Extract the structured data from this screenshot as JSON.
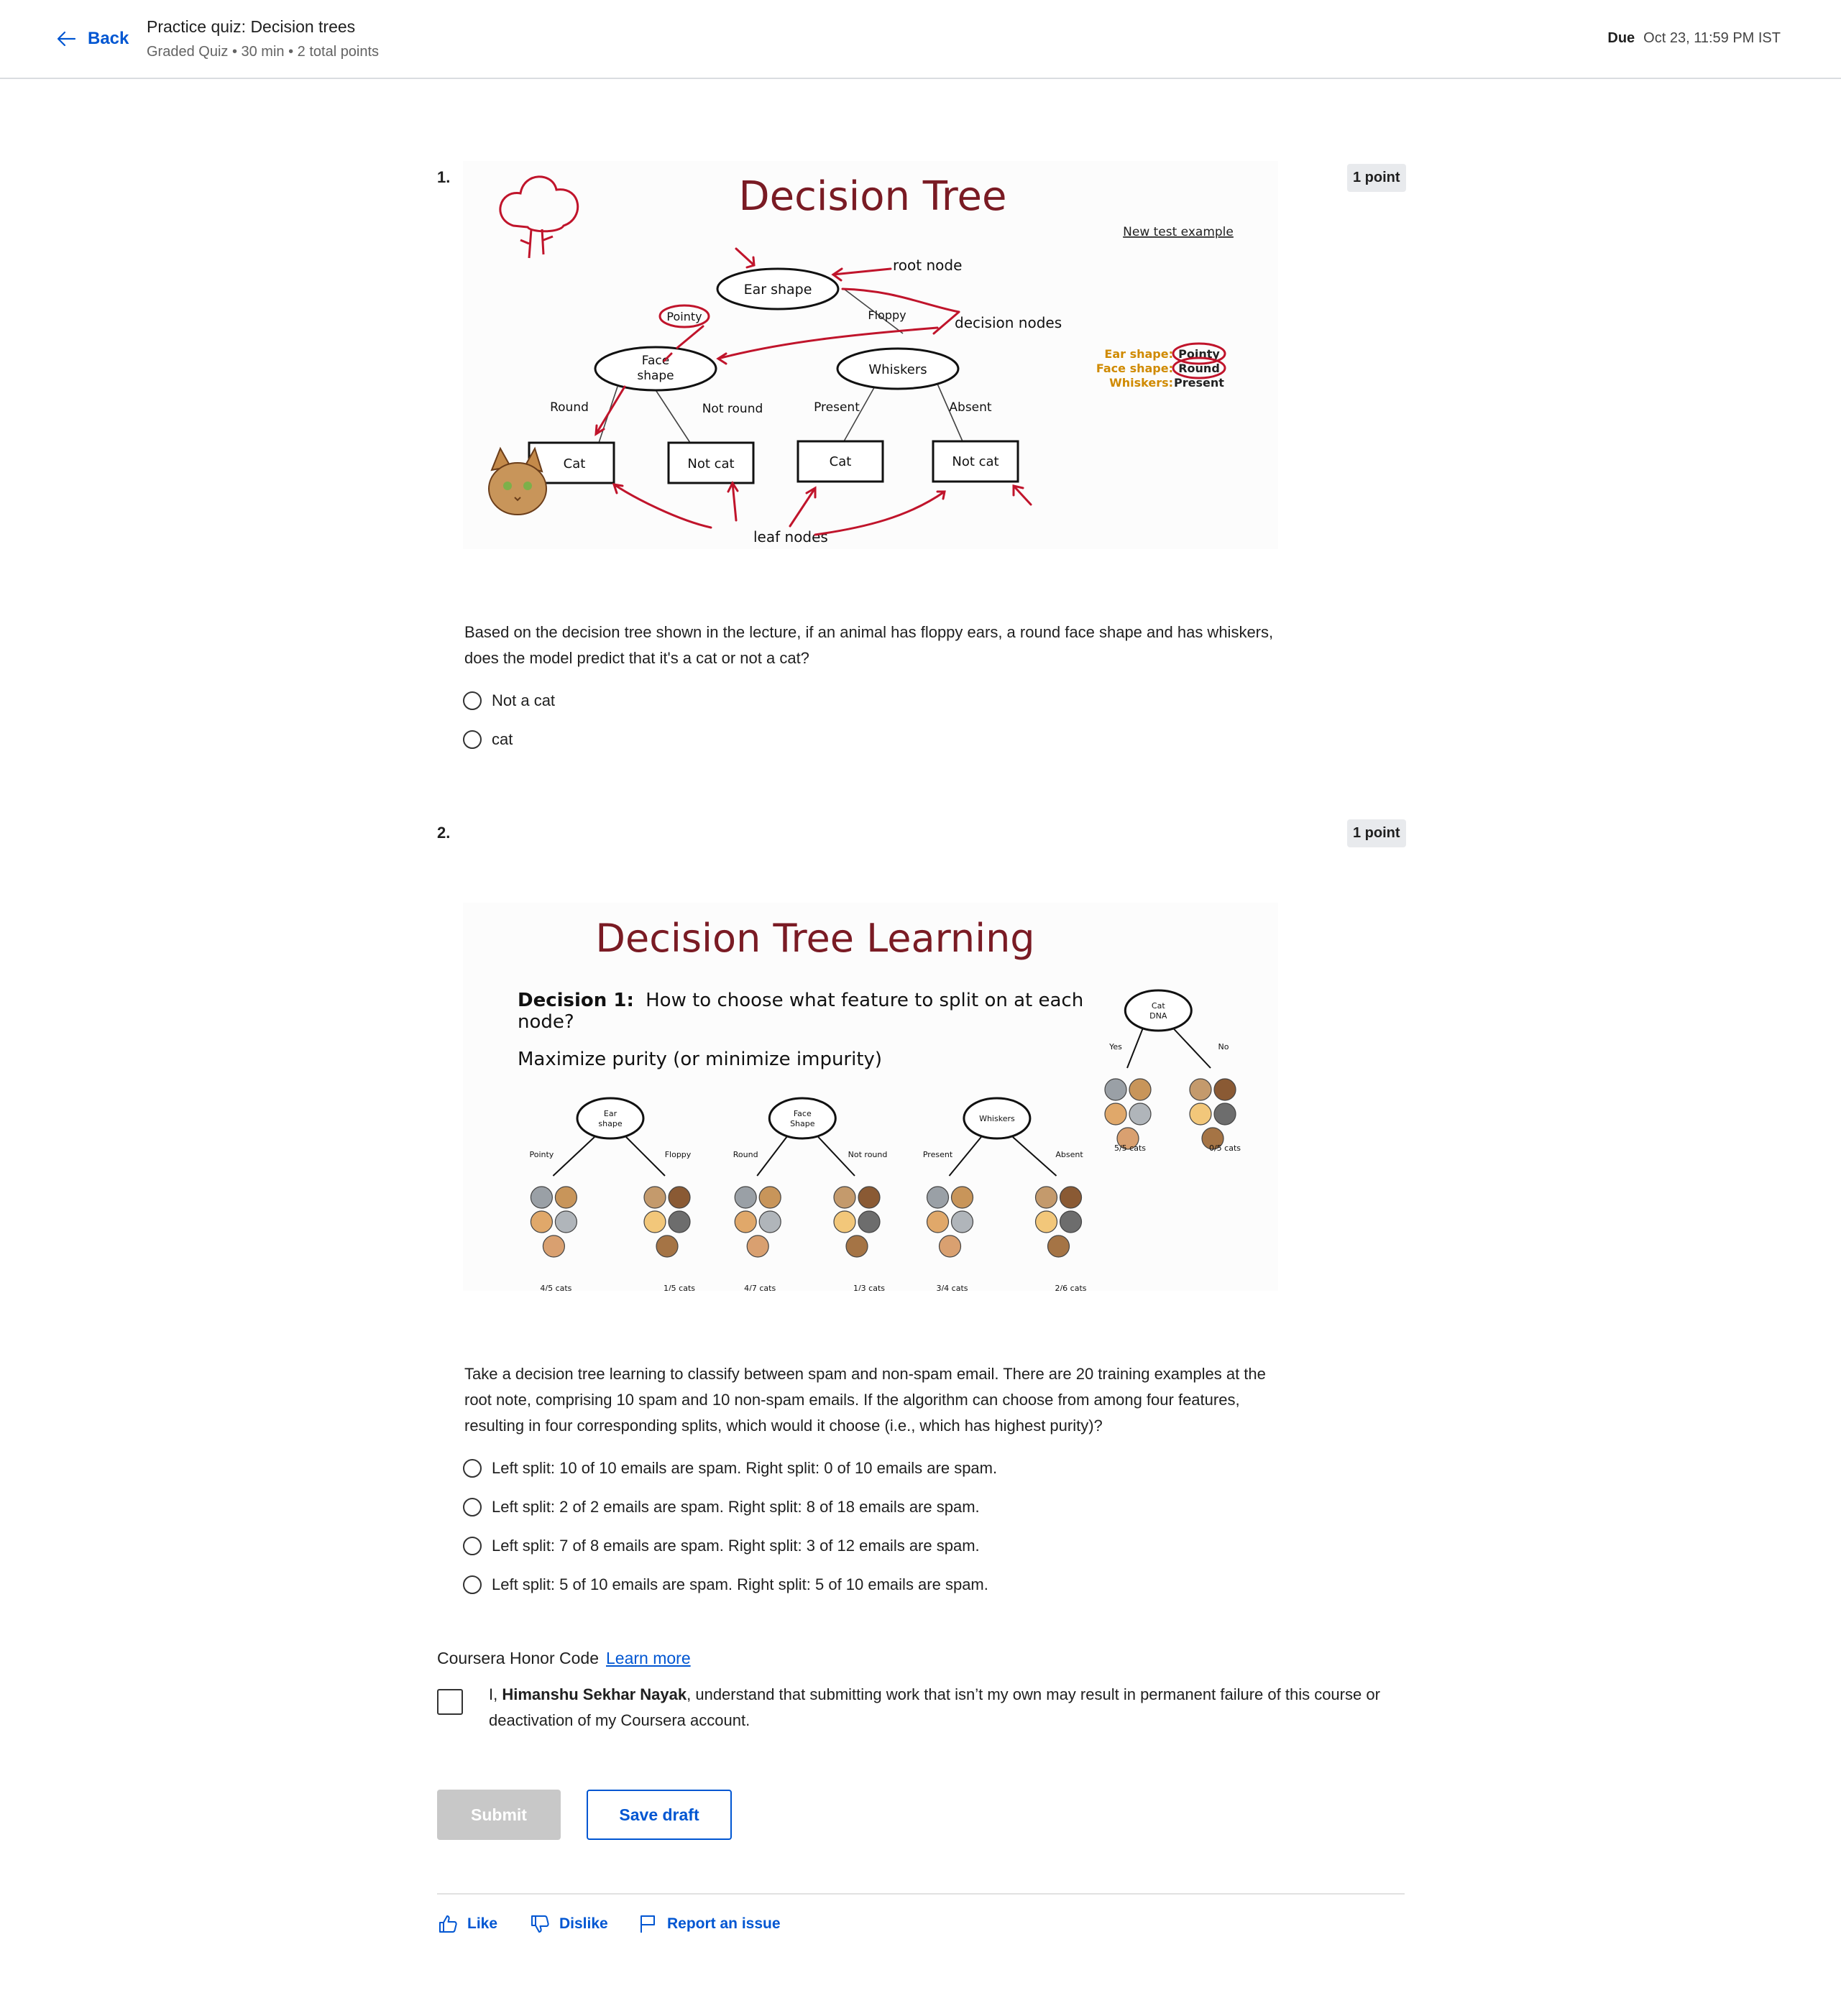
{
  "header": {
    "back_label": "Back",
    "quiz_title": "Practice quiz: Decision trees",
    "quiz_meta": "Graded Quiz • 30 min • 2 total points",
    "due_label": "Due",
    "due_value": "Oct 23, 11:59 PM IST"
  },
  "questions": [
    {
      "number": "1.",
      "points": "1 point",
      "figure": {
        "title": "Decision Tree",
        "labels": {
          "root_node": "root node",
          "decision_nodes": "decision nodes",
          "leaf_nodes": "leaf nodes",
          "new_test_example": "New test example",
          "ear_shape": "Ear shape",
          "face_shape_l1": "Face",
          "face_shape_l2": "shape",
          "whiskers": "Whiskers",
          "pointy": "Pointy",
          "floppy": "Floppy",
          "round": "Round",
          "not_round": "Not round",
          "present": "Present",
          "absent": "Absent",
          "cat": "Cat",
          "not_cat": "Not cat",
          "ex_ear": "Ear shape:",
          "ex_face": "Face shape:",
          "ex_whiskers": "Whiskers:",
          "ex_ear_val": "Pointy",
          "ex_face_val": "Round",
          "ex_whiskers_val": "Present"
        }
      },
      "text": "Based on the decision tree shown in the lecture, if an animal has floppy ears, a round face shape and has whiskers, does the model predict that it's a cat or not a cat?",
      "options": [
        "Not a cat",
        "cat"
      ]
    },
    {
      "number": "2.",
      "points": "1 point",
      "figure": {
        "title": "Decision Tree Learning",
        "decision_bold": "Decision 1:",
        "decision_text_1": "How to choose what feature to split on at each",
        "decision_text_2": "node?",
        "subtitle": "Maximize purity (or minimize impurity)",
        "trees": [
          {
            "node_l1": "Ear",
            "node_l2": "shape",
            "left": "Pointy",
            "right": "Floppy",
            "left_count": "4/5 cats",
            "right_count": "1/5 cats"
          },
          {
            "node_l1": "Face",
            "node_l2": "Shape",
            "left": "Round",
            "right": "Not round",
            "left_count": "4/7 cats",
            "right_count": "1/3 cats"
          },
          {
            "node_l1": "Whiskers",
            "node_l2": "",
            "left": "Present",
            "right": "Absent",
            "left_count": "3/4 cats",
            "right_count": "2/6 cats"
          },
          {
            "node_l1": "Cat",
            "node_l2": "DNA",
            "left": "Yes",
            "right": "No",
            "left_count": "5/5 cats",
            "right_count": "0/5 cats"
          }
        ]
      },
      "text": "Take a decision tree learning to classify between spam and non-spam email. There are 20 training examples at the root note, comprising 10 spam and 10 non-spam emails. If the algorithm can choose from among four features, resulting in four corresponding splits, which would it choose (i.e., which has highest purity)?",
      "options": [
        "Left split: 10 of 10 emails are spam. Right split: 0 of 10 emails are spam.",
        "Left split: 2 of 2 emails are spam. Right split: 8 of 18 emails are spam.",
        "Left split: 7 of 8 emails are spam. Right split: 3 of 12 emails are spam.",
        "Left split: 5 of 10 emails are spam. Right split: 5 of 10 emails are spam."
      ]
    }
  ],
  "honor": {
    "title": "Coursera Honor Code",
    "learn_more": "Learn more",
    "prefix": "I, ",
    "name": "Himanshu Sekhar Nayak",
    "suffix": ", understand that submitting work that isn’t my own may result in permanent failure of this course or deactivation of my Coursera account."
  },
  "actions": {
    "submit": "Submit",
    "save_draft": "Save draft"
  },
  "footer": {
    "like": "Like",
    "dislike": "Dislike",
    "report": "Report an issue"
  },
  "colors": {
    "accent": "#0056d2",
    "annotation_red": "#c0142b",
    "title_red": "#7a1b24",
    "example_orange": "#d08a00"
  }
}
